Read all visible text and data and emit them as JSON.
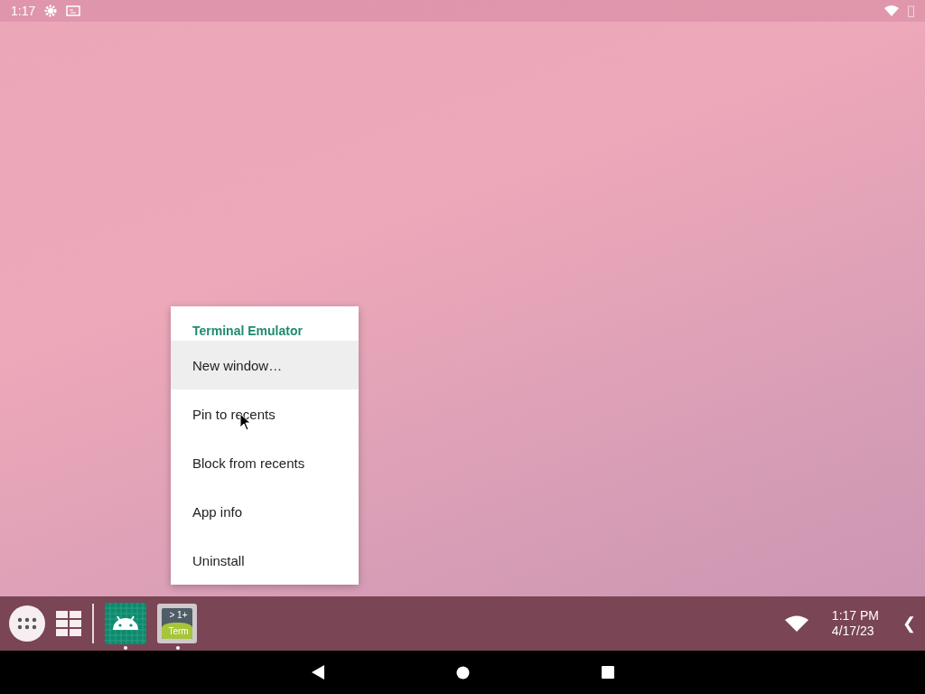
{
  "status_bar": {
    "time": "1:17"
  },
  "context_menu": {
    "title": "Terminal Emulator",
    "items": [
      {
        "label": "New window…",
        "selected": true
      },
      {
        "label": "Pin to recents",
        "selected": false
      },
      {
        "label": "Block from recents",
        "selected": false
      },
      {
        "label": "App info",
        "selected": false
      },
      {
        "label": "Uninstall",
        "selected": false
      }
    ]
  },
  "taskbar": {
    "apps": [
      {
        "kind": "android",
        "running": true
      },
      {
        "kind": "terminal",
        "running": true,
        "icon_lines": [
          "> 1+",
          "Term"
        ]
      }
    ],
    "clock_time": "1:17 PM",
    "clock_date": "4/17/23",
    "collapse": "❮"
  }
}
